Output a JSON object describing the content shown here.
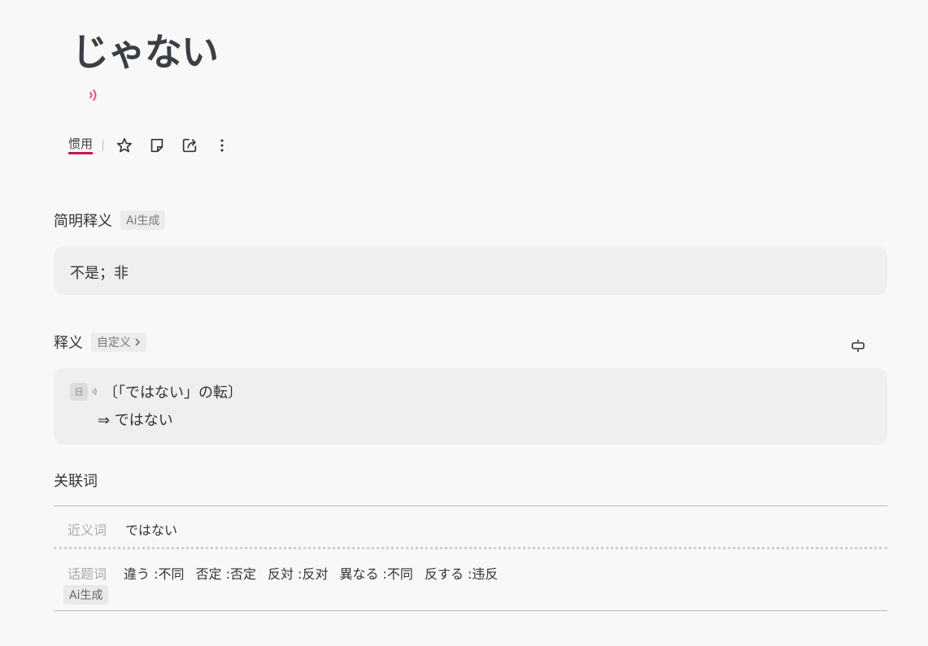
{
  "word": {
    "headword": "じゃない",
    "tag": "惯用"
  },
  "toolbar": {
    "icons": [
      "star-icon",
      "note-icon",
      "share-icon",
      "more-icon"
    ]
  },
  "brief": {
    "title": "简明释义",
    "chip": "Ai生成",
    "text": "不是；非"
  },
  "definition": {
    "title": "释义",
    "chip": "自定义",
    "badge": "日",
    "line1": "〔「ではない」の転〕",
    "line2": "⇒ ではない"
  },
  "related": {
    "title": "关联词",
    "synonym_label": "近义词",
    "synonym_value": "ではない",
    "topic_label": "话题词",
    "topics": [
      "違う :不同",
      "否定 :否定",
      "反対 :反对",
      "異なる :不同",
      "反する :违反"
    ],
    "topic_chip": "Ai生成"
  },
  "colors": {
    "accent": "#c2185b",
    "sound": "#e9546b"
  }
}
